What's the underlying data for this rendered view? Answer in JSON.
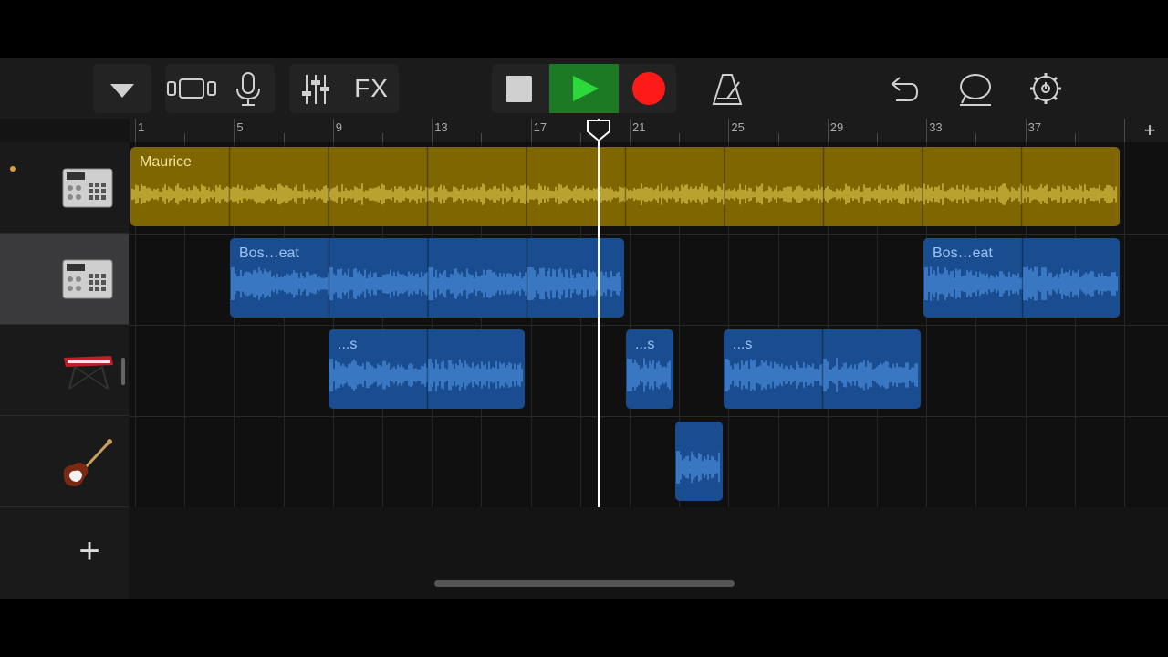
{
  "colors": {
    "audio_region": "#806600",
    "audio_wave": "#f0dc60",
    "loop_region": "#1a4d8f",
    "loop_wave": "#5aa0f5",
    "record": "#ff1a1a",
    "play_bg": "#1c7a24",
    "play": "#2bd93a"
  },
  "toolbar": {
    "tracks_menu_icon": "triangle-down-icon",
    "track_view_icon": "tracks-view-icon",
    "mic_icon": "microphone-icon",
    "mixer_icon": "mixer-sliders-icon",
    "fx_label": "FX",
    "stop_icon": "stop-icon",
    "play_icon": "play-icon",
    "record_icon": "record-icon",
    "metronome_icon": "metronome-icon",
    "undo_icon": "undo-icon",
    "loop_icon": "loop-browser-icon",
    "settings_icon": "gear-icon"
  },
  "ruler": {
    "bars": [
      "1",
      "5",
      "9",
      "13",
      "17",
      "21",
      "25",
      "29",
      "33",
      "37"
    ],
    "add_label": "+"
  },
  "tracks": [
    {
      "instrument": "drum-machine-icon",
      "selected": false,
      "regions": [
        {
          "label": "Maurice"
        }
      ]
    },
    {
      "instrument": "drum-machine-icon",
      "selected": true,
      "regions": [
        {
          "label": "Bos…eat"
        },
        {
          "label": "Bos…eat"
        }
      ]
    },
    {
      "instrument": "keyboard-icon",
      "selected": false,
      "regions": [
        {
          "label": "...s"
        },
        {
          "label": "...s"
        },
        {
          "label": "...s"
        }
      ]
    },
    {
      "instrument": "guitar-icon",
      "selected": false,
      "regions": [
        {
          "label": ""
        }
      ]
    }
  ],
  "add_track_label": "+"
}
